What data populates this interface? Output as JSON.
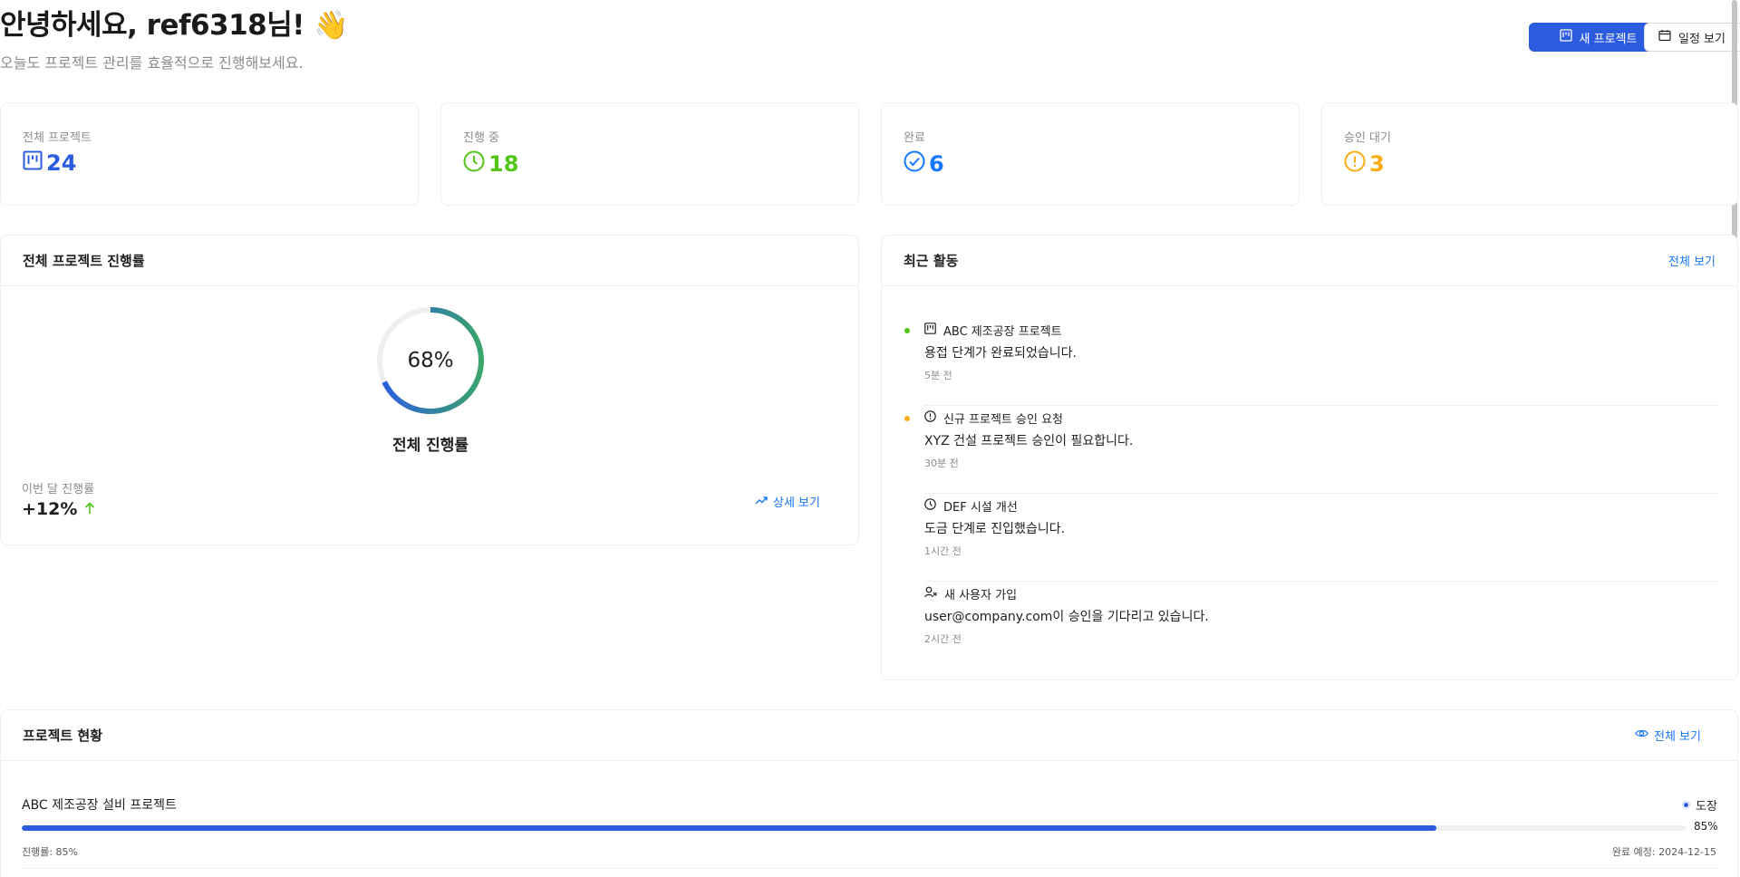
{
  "header": {
    "greeting": "안녕하세요, ref6318님! 👋",
    "subtitle": "오늘도 프로젝트 관리를 효율적으로 진행해보세요.",
    "new_project_label": "새 프로젝트",
    "schedule_label": "일정 보기"
  },
  "stats": [
    {
      "label": "전체 프로젝트",
      "value": "24",
      "icon": "project-icon",
      "color": "#2b5ce0"
    },
    {
      "label": "진행 중",
      "value": "18",
      "icon": "clock-icon",
      "color": "#52c41a"
    },
    {
      "label": "완료",
      "value": "6",
      "icon": "check-circle-icon",
      "color": "#1677ff"
    },
    {
      "label": "승인 대기",
      "value": "3",
      "icon": "exclamation-circle-icon",
      "color": "#faad14"
    }
  ],
  "progress": {
    "title": "전체 프로젝트 진행률",
    "percent_label": "68%",
    "percent_value": 0.68,
    "caption": "전체 진행률",
    "month_label": "이번 달 진행률",
    "month_value": "+12%",
    "detail_link": "상세 보기"
  },
  "activity": {
    "title": "최근 활동",
    "view_all": "전체 보기",
    "items": [
      {
        "icon": "project-icon",
        "title": "ABC 제조공장 프로젝트",
        "desc": "용접 단계가 완료되었습니다.",
        "time": "5분 전",
        "dot": "#52c41a"
      },
      {
        "icon": "exclamation-circle-icon",
        "title": "신규 프로젝트 승인 요청",
        "desc": "XYZ 건설 프로젝트 승인이 필요합니다.",
        "time": "30분 전",
        "dot": "#faad14"
      },
      {
        "icon": "clock-icon",
        "title": "DEF 시설 개선",
        "desc": "도금 단계로 진입했습니다.",
        "time": "1시간 전",
        "dot": ""
      },
      {
        "icon": "user-add-icon",
        "title": "새 사용자 가입",
        "desc": "user@company.com이 승인을 기다리고 있습니다.",
        "time": "2시간 전",
        "dot": ""
      }
    ]
  },
  "projects": {
    "title": "프로젝트 현황",
    "view_all": "전체 보기",
    "items": [
      {
        "name": "ABC 제조공장 설비 프로젝트",
        "stage": "도장",
        "percent": 0.85,
        "percent_label": "85%",
        "progress_text": "진행률: 85%",
        "due_text": "완료 예정: 2024-12-15"
      }
    ]
  },
  "colors": {
    "primary": "#2b5ce0",
    "link": "#1677ff",
    "success": "#52c41a",
    "warning": "#faad14"
  }
}
